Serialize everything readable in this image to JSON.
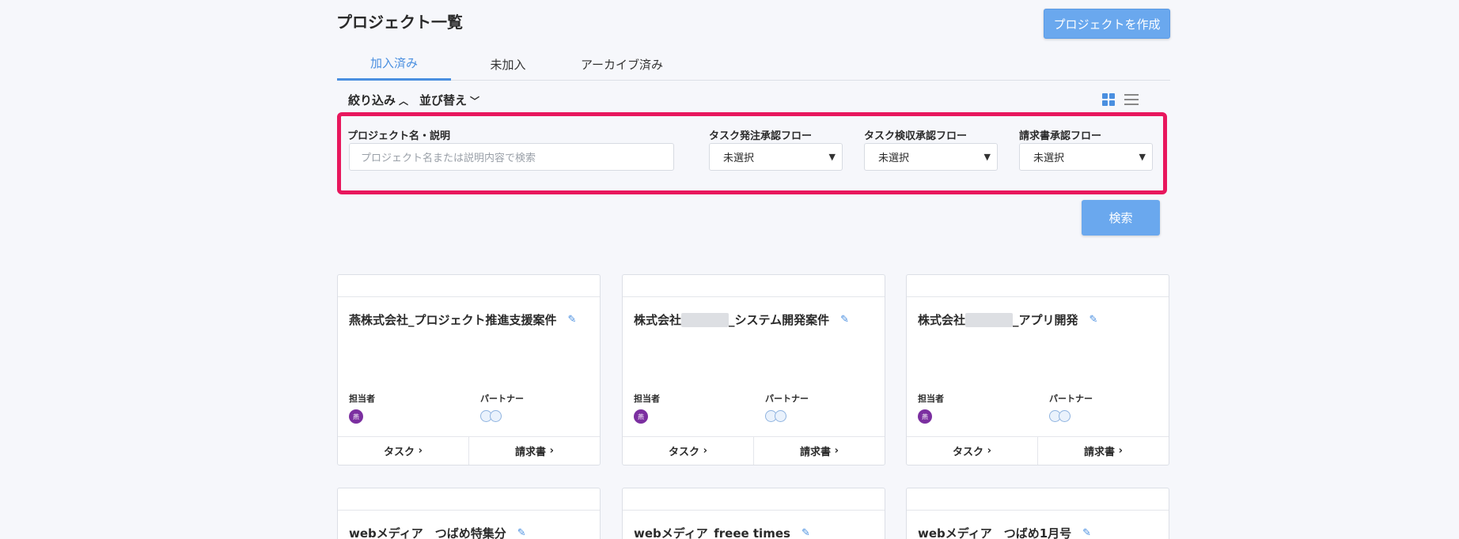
{
  "page": {
    "title": "プロジェクト一覧",
    "create_button": "プロジェクトを作成"
  },
  "tabs": [
    {
      "label": "加入済み",
      "active": true
    },
    {
      "label": "未加入",
      "active": false
    },
    {
      "label": "アーカイブ済み",
      "active": false
    }
  ],
  "toolbar": {
    "filter_label": "絞り込み",
    "sort_label": "並び替え",
    "view_grid_icon": "grid-view-icon",
    "view_list_icon": "list-view-icon"
  },
  "search": {
    "name_label": "プロジェクト名・説明",
    "name_placeholder": "プロジェクト名または説明内容で検索",
    "order_flow_label": "タスク発注承認フロー",
    "order_flow_value": "未選択",
    "inspection_flow_label": "タスク検収承認フロー",
    "inspection_flow_value": "未選択",
    "invoice_flow_label": "請求書承認フロー",
    "invoice_flow_value": "未選択",
    "search_button": "検索"
  },
  "colors": {
    "accent": "#4a8fe0",
    "highlight": "#e8175d",
    "avatar": "#7b2fa0"
  },
  "cards": [
    {
      "title": "燕株式会社_プロジェクト推進支援案件",
      "owner_label": "担当者",
      "partner_label": "パートナー",
      "owner_initial": "燕",
      "tasks_label": "タスク",
      "invoice_label": "請求書"
    },
    {
      "title_prefix": "株式会社",
      "title_suffix": "_システム開発案件",
      "owner_label": "担当者",
      "partner_label": "パートナー",
      "owner_initial": "燕",
      "tasks_label": "タスク",
      "invoice_label": "請求書"
    },
    {
      "title_prefix": "株式会社",
      "title_suffix": "_アプリ開発",
      "owner_label": "担当者",
      "partner_label": "パートナー",
      "owner_initial": "燕",
      "tasks_label": "タスク",
      "invoice_label": "請求書"
    },
    {
      "title": "webメディア__つばめ特集分"
    },
    {
      "title": "webメディア_freee times"
    },
    {
      "title": "webメディア__つばめ1月号"
    }
  ]
}
